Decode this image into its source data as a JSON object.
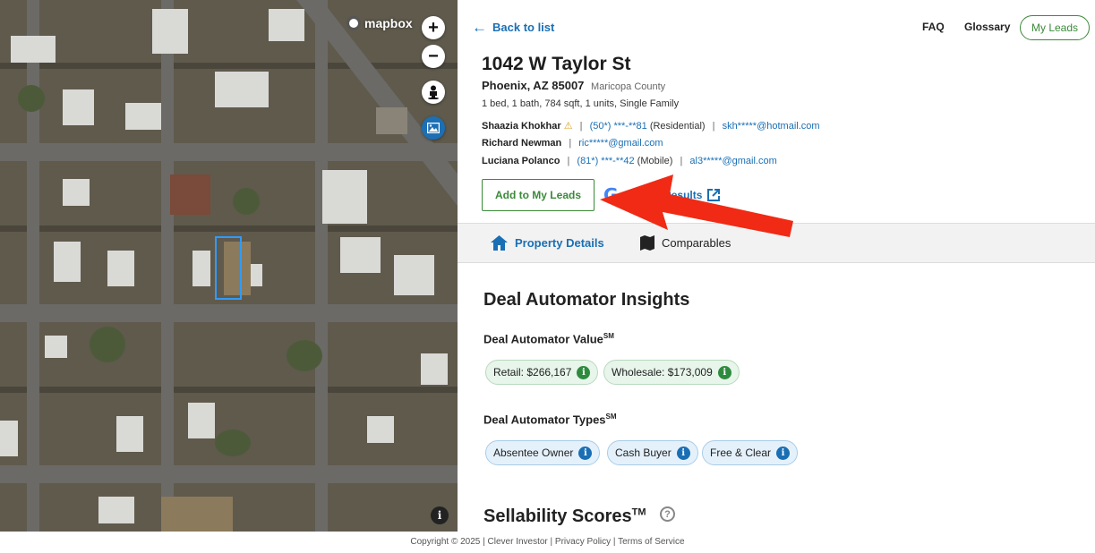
{
  "map": {
    "brand": "mapbox",
    "controls": [
      "zoom-in",
      "zoom-out",
      "street-view",
      "satellite-toggle"
    ],
    "zoom_in_label": "+",
    "zoom_out_label": "−",
    "info_label": "i"
  },
  "nav": {
    "back_label": "Back to list",
    "faq": "FAQ",
    "glossary": "Glossary",
    "my_leads": "My Leads"
  },
  "property": {
    "address": "1042 W Taylor St",
    "city": "Phoenix, AZ 85007",
    "county": "Maricopa County",
    "specs": "1 bed, 1 bath, 784 sqft, 1 units, Single Family"
  },
  "owners": [
    {
      "name": "Shaazia Khokhar",
      "warn": "⚠",
      "phone": "(50*) ***-**81",
      "phone_type": "(Residential)",
      "email": "skh*****@hotmail.com"
    },
    {
      "name": "Richard Newman",
      "email": "ric*****@gmail.com"
    },
    {
      "name": "Luciana Polanco",
      "phone": "(81*) ***-**42",
      "phone_type": "(Mobile)",
      "email": "al3*****@gmail.com"
    }
  ],
  "actions": {
    "add_to_leads": "Add to My Leads",
    "google_g": "G",
    "google_results": "Google Results"
  },
  "tabs": {
    "details": "Property Details",
    "comparables": "Comparables"
  },
  "insights": {
    "title": "Deal Automator Insights",
    "value_label": "Deal Automator Value",
    "value_sup": "SM",
    "retail": "Retail: $266,167",
    "wholesale": "Wholesale: $173,009",
    "types_label": "Deal Automator Types",
    "types_sup": "SM",
    "types": [
      "Absentee Owner",
      "Cash Buyer",
      "Free & Clear"
    ],
    "info_glyph": "i"
  },
  "sellability": {
    "title": "Sellability Scores",
    "sup": "TM",
    "help": "?"
  },
  "footer": "Copyright © 2025 | Clever Investor | Privacy Policy | Terms of Service",
  "colors": {
    "link": "#1a6fb4",
    "green": "#3b8a3a",
    "arrow": "#f02a14"
  }
}
